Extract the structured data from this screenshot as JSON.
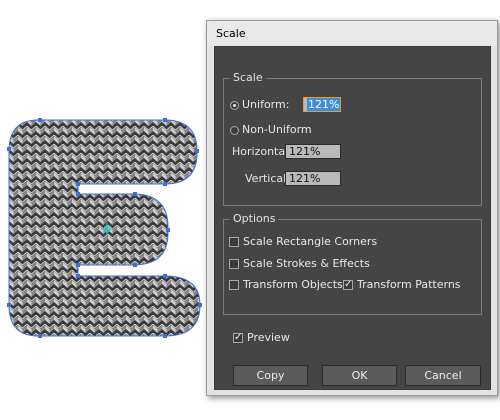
{
  "dialog": {
    "title": "Scale",
    "scale_group": {
      "label": "Scale",
      "uniform_label": "Uniform:",
      "uniform_value": "121%",
      "uniform_selected": true,
      "non_uniform_label": "Non-Uniform",
      "horizontal_label": "Horizontal:",
      "horizontal_value": "121%",
      "vertical_label": "Vertical:",
      "vertical_value": "121%"
    },
    "options_group": {
      "label": "Options",
      "scale_rectangle_corners": {
        "label": "Scale Rectangle Corners",
        "checked": false
      },
      "scale_strokes_effects": {
        "label": "Scale Strokes & Effects",
        "checked": false
      },
      "transform_objects": {
        "label": "Transform Objects",
        "checked": false
      },
      "transform_patterns": {
        "label": "Transform Patterns",
        "checked": true
      }
    },
    "preview": {
      "label": "Preview",
      "checked": true
    },
    "buttons": {
      "copy": "Copy",
      "ok": "OK",
      "cancel": "Cancel"
    }
  },
  "artwork": {
    "fill_pattern": "knit-chevron-pattern",
    "selection_color": "#3a6fd8",
    "center_marker_color": "#3cc6c6"
  }
}
